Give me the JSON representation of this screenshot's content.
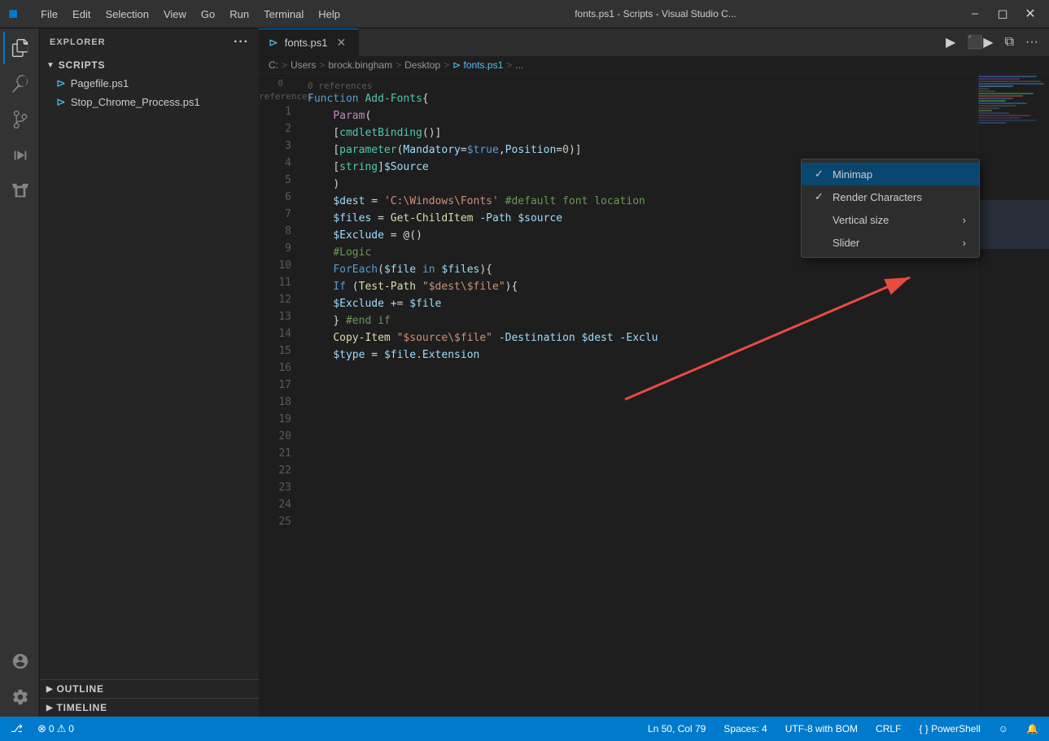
{
  "titlebar": {
    "logo": "⬡",
    "menu": [
      "File",
      "Edit",
      "Selection",
      "View",
      "Go",
      "Run",
      "Terminal",
      "Help"
    ],
    "title": "fonts.ps1 - Scripts - Visual Studio C...",
    "controls": [
      "⬜",
      "❐",
      "✕"
    ],
    "window_icon_src": ""
  },
  "tabs": {
    "active_tab": "fonts.ps1",
    "tabs": [
      {
        "label": "fonts.ps1",
        "icon": "⊳",
        "active": true
      }
    ]
  },
  "toolbar": {
    "run_icon": "▶",
    "debug_icon": "⬛▶",
    "split_icon": "⧉",
    "more_icon": "···"
  },
  "breadcrumb": {
    "items": [
      "C:",
      "Users",
      "brock.bingham",
      "Desktop",
      "⊳ fonts.ps1",
      "..."
    ]
  },
  "editor": {
    "references": "0 references",
    "lines": [
      {
        "num": 1,
        "code": "Function Add-Fonts{",
        "tokens": [
          {
            "text": "Function ",
            "class": "kw"
          },
          {
            "text": "Add-Fonts",
            "class": "fn-name"
          },
          {
            "text": "{",
            "class": "punct"
          }
        ]
      },
      {
        "num": 2,
        "code": "    Param(",
        "tokens": [
          {
            "text": "    "
          },
          {
            "text": "Param",
            "class": "fn"
          },
          {
            "text": "(",
            "class": "punct"
          }
        ]
      },
      {
        "num": 3,
        "code": "    [cmdletBinding()]",
        "tokens": [
          {
            "text": "    "
          },
          {
            "text": "[",
            "class": "punct"
          },
          {
            "text": "cmdletBinding",
            "class": "attr"
          },
          {
            "text": "()",
            "class": "punct"
          },
          {
            "text": "]",
            "class": "punct"
          }
        ]
      },
      {
        "num": 4,
        "code": "    [parameter(Mandatory=$true,Position=0)]",
        "tokens": [
          {
            "text": "    "
          },
          {
            "text": "[",
            "class": "punct"
          },
          {
            "text": "parameter",
            "class": "attr"
          },
          {
            "text": "(",
            "class": "punct"
          },
          {
            "text": "Mandatory",
            "class": "param"
          },
          {
            "text": "=",
            "class": "op"
          },
          {
            "text": "$true",
            "class": "kw"
          },
          {
            "text": ",",
            "class": "punct"
          },
          {
            "text": "Position",
            "class": "param"
          },
          {
            "text": "=",
            "class": "op"
          },
          {
            "text": "0",
            "class": "param"
          },
          {
            "text": ")]",
            "class": "punct"
          }
        ]
      },
      {
        "num": 5,
        "code": "    [string]$Source",
        "tokens": [
          {
            "text": "    "
          },
          {
            "text": "[",
            "class": "punct"
          },
          {
            "text": "string",
            "class": "type"
          },
          {
            "text": "]",
            "class": "punct"
          },
          {
            "text": "$Source",
            "class": "var"
          }
        ]
      },
      {
        "num": 6,
        "code": "",
        "tokens": []
      },
      {
        "num": 7,
        "code": "    )",
        "tokens": [
          {
            "text": "    "
          },
          {
            "text": ")",
            "class": "punct"
          }
        ]
      },
      {
        "num": 8,
        "code": "",
        "tokens": []
      },
      {
        "num": 9,
        "code": "",
        "tokens": []
      },
      {
        "num": 10,
        "code": "",
        "tokens": []
      },
      {
        "num": 11,
        "code": "    $dest = 'C:\\Windows\\Fonts' #default font location",
        "tokens": [
          {
            "text": "    "
          },
          {
            "text": "$dest",
            "class": "var"
          },
          {
            "text": " = ",
            "class": "op"
          },
          {
            "text": "'C:\\Windows\\Fonts'",
            "class": "str"
          },
          {
            "text": " ",
            "class": ""
          },
          {
            "text": "#default font location",
            "class": "comment"
          }
        ]
      },
      {
        "num": 12,
        "code": "    $files = Get-ChildItem -Path $source",
        "tokens": [
          {
            "text": "    "
          },
          {
            "text": "$files",
            "class": "var"
          },
          {
            "text": " = ",
            "class": "op"
          },
          {
            "text": "Get-ChildItem",
            "class": "fn"
          },
          {
            "text": " ",
            "class": ""
          },
          {
            "text": "-Path",
            "class": "param"
          },
          {
            "text": " ",
            "class": ""
          },
          {
            "text": "$source",
            "class": "var"
          }
        ]
      },
      {
        "num": 13,
        "code": "    $Exclude = @()",
        "tokens": [
          {
            "text": "    "
          },
          {
            "text": "$Exclude",
            "class": "var"
          },
          {
            "text": " = ",
            "class": "op"
          },
          {
            "text": "@()",
            "class": "punct"
          }
        ]
      },
      {
        "num": 14,
        "code": "",
        "tokens": []
      },
      {
        "num": 15,
        "code": "",
        "tokens": []
      },
      {
        "num": 16,
        "code": "",
        "tokens": []
      },
      {
        "num": 17,
        "code": "    #Logic",
        "tokens": [
          {
            "text": "    "
          },
          {
            "text": "#Logic",
            "class": "comment"
          }
        ]
      },
      {
        "num": 18,
        "code": "    ForEach($file in $files){",
        "tokens": [
          {
            "text": "    "
          },
          {
            "text": "ForEach",
            "class": "kw"
          },
          {
            "text": "(",
            "class": "punct"
          },
          {
            "text": "$file",
            "class": "var"
          },
          {
            "text": " in ",
            "class": "kw"
          },
          {
            "text": "$files",
            "class": "var"
          },
          {
            "text": "){",
            "class": "punct"
          }
        ]
      },
      {
        "num": 19,
        "code": "    If (Test-Path \"$dest\\$file\"){",
        "tokens": [
          {
            "text": "    "
          },
          {
            "text": "If ",
            "class": "kw"
          },
          {
            "text": "(",
            "class": "punct"
          },
          {
            "text": "Test-Path",
            "class": "fn"
          },
          {
            "text": " ",
            "class": ""
          },
          {
            "text": "\"$dest\\$file\"",
            "class": "str"
          },
          {
            "text": "){",
            "class": "punct"
          }
        ]
      },
      {
        "num": 20,
        "code": "    $Exclude += $file",
        "tokens": [
          {
            "text": "    "
          },
          {
            "text": "$Exclude",
            "class": "var"
          },
          {
            "text": " += ",
            "class": "op"
          },
          {
            "text": "$file",
            "class": "var"
          }
        ]
      },
      {
        "num": 21,
        "code": "    } #end if",
        "tokens": [
          {
            "text": "    "
          },
          {
            "text": "} ",
            "class": "punct"
          },
          {
            "text": "#end if",
            "class": "comment"
          }
        ]
      },
      {
        "num": 22,
        "code": "",
        "tokens": []
      },
      {
        "num": 23,
        "code": "    Copy-Item \"$source\\$file\" -Destination $dest -Exclu",
        "tokens": [
          {
            "text": "    "
          },
          {
            "text": "Copy-Item",
            "class": "fn"
          },
          {
            "text": " ",
            "class": ""
          },
          {
            "text": "\"$source\\$file\"",
            "class": "str"
          },
          {
            "text": " ",
            "class": ""
          },
          {
            "text": "-Destination",
            "class": "param"
          },
          {
            "text": " ",
            "class": ""
          },
          {
            "text": "$dest",
            "class": "var"
          },
          {
            "text": " ",
            "class": ""
          },
          {
            "text": "-Exclu",
            "class": "param"
          }
        ]
      },
      {
        "num": 24,
        "code": "",
        "tokens": []
      },
      {
        "num": 25,
        "code": "    $type = $file.Extension",
        "tokens": [
          {
            "text": "    "
          },
          {
            "text": "$type",
            "class": "var"
          },
          {
            "text": " = ",
            "class": "op"
          },
          {
            "text": "$file",
            "class": "var"
          },
          {
            "text": ".Extension",
            "class": "param"
          }
        ]
      }
    ]
  },
  "explorer": {
    "header": "EXPLORER",
    "more_icon": "···",
    "scripts_section": {
      "label": "SCRIPTS",
      "items": [
        {
          "name": "Pagefile.ps1",
          "icon": "⊳"
        },
        {
          "name": "Stop_Chrome_Process.ps1",
          "icon": "⊳"
        }
      ]
    },
    "outline_label": "OUTLINE",
    "timeline_label": "TIMELINE"
  },
  "context_menu": {
    "items": [
      {
        "label": "Minimap",
        "checked": true,
        "has_submenu": false
      },
      {
        "label": "Render Characters",
        "checked": true,
        "has_submenu": false
      },
      {
        "label": "Vertical size",
        "checked": false,
        "has_submenu": true
      },
      {
        "label": "Slider",
        "checked": false,
        "has_submenu": true
      }
    ]
  },
  "status_bar": {
    "errors": "0",
    "warnings": "0",
    "position": "Ln 50, Col 79",
    "spaces": "Spaces: 4",
    "encoding": "UTF-8 with BOM",
    "line_ending": "CRLF",
    "language": "{ } PowerShell",
    "feedback_icon": "☺",
    "bell_icon": "🔔"
  }
}
